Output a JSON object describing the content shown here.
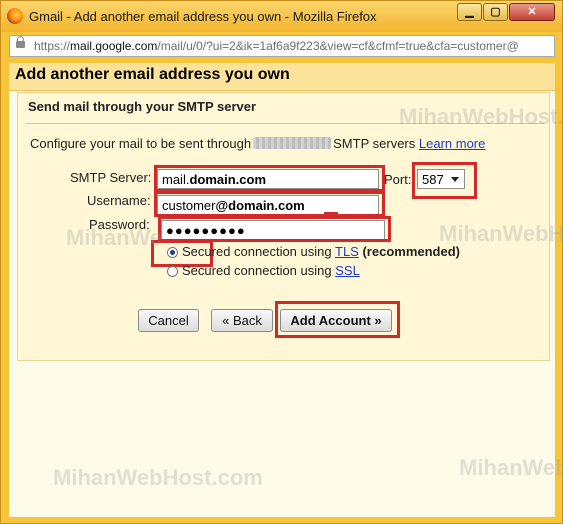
{
  "window": {
    "title": "Gmail - Add another email address you own - Mozilla Firefox",
    "minimize_glyph": "▁",
    "maximize_glyph": "▢",
    "close_glyph": "✕"
  },
  "urlbar": {
    "prefix": "https://",
    "domain": "mail.google.com",
    "path": "/mail/u/0/?ui=2&ik=1af6a9f223&view=cf&cfmf=true&cfa=customer@"
  },
  "page": {
    "title": "Add another email address you own"
  },
  "section": {
    "title": "Send mail through your SMTP server",
    "desc_before": "Configure your mail to be sent through",
    "desc_after": "SMTP servers",
    "learn_more": "Learn more"
  },
  "form": {
    "smtp_label": "SMTP Server:",
    "smtp_value_plain": "mail.",
    "smtp_value_bold": "domain.com",
    "port_label": "Port:",
    "port_value": "587",
    "username_label": "Username:",
    "username_value_plain": "customer",
    "username_value_bold": "@domain.com",
    "password_label": "Password:",
    "password_value": "●●●●●●●●●",
    "tls_text": "Secured connection using",
    "tls_link": "TLS",
    "tls_suffix": "(recommended)",
    "ssl_text": "Secured connection using",
    "ssl_link": "SSL"
  },
  "buttons": {
    "cancel": "Cancel",
    "back": "« Back",
    "add_account": "Add Account »"
  },
  "watermark": {
    "text": "MihanWebHost.com",
    "text_short": "MihanWe"
  },
  "colors": {
    "window_chrome": "#f7c53a",
    "content_bg": "#fffbe9",
    "highlight": "#d12a2a",
    "link": "#1a3ec9"
  }
}
